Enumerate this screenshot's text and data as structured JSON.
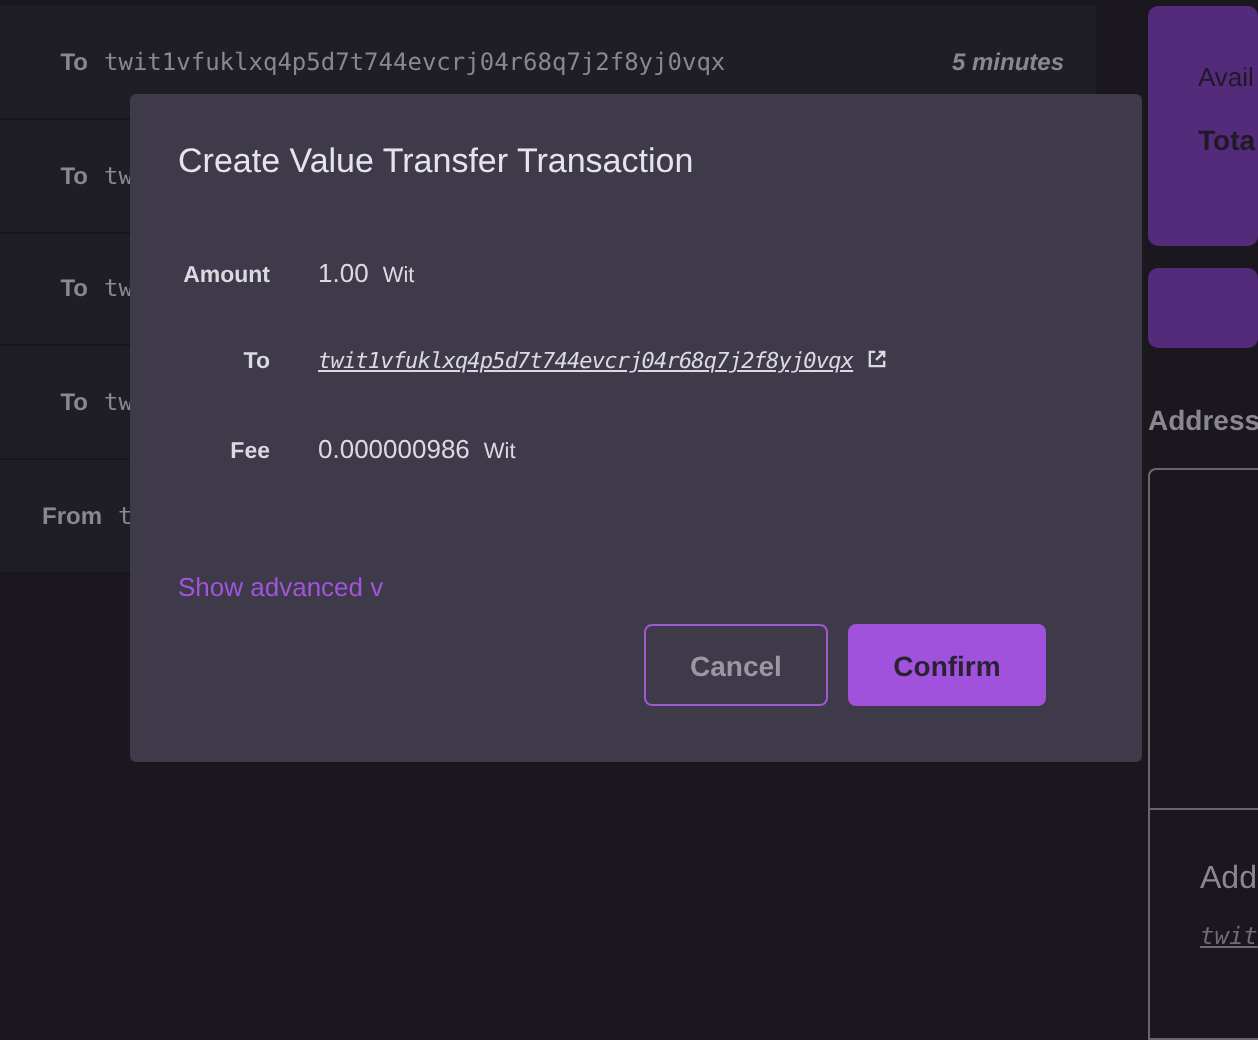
{
  "transactions": [
    {
      "direction": "To",
      "address": "twit1vfuklxq4p5d7t744evcrj04r68q7j2f8yj0vqx",
      "time": "5 minutes"
    },
    {
      "direction": "To",
      "address": "tw"
    },
    {
      "direction": "To",
      "address": "tw"
    },
    {
      "direction": "To",
      "address": "tw"
    },
    {
      "direction": "From",
      "address": "t"
    }
  ],
  "balance_card": {
    "available": "Avail",
    "total": "Tota"
  },
  "addresses": {
    "title": "Address",
    "item_title": "Add",
    "item_address": "twit"
  },
  "modal": {
    "title": "Create Value Transfer Transaction",
    "fields": [
      {
        "kind": "amount",
        "label": "Amount",
        "value": "1.00",
        "unit": "Wit"
      },
      {
        "kind": "link",
        "label": "To",
        "value": "twit1vfuklxq4p5d7t744evcrj04r68q7j2f8yj0vqx"
      },
      {
        "kind": "amount",
        "label": "Fee",
        "value": "0.000000986",
        "unit": "Wit"
      }
    ],
    "advanced_toggle": "Show advanced v",
    "buttons": [
      {
        "kind": "secondary",
        "label": "Cancel"
      },
      {
        "kind": "primary",
        "label": "Confirm"
      }
    ]
  }
}
